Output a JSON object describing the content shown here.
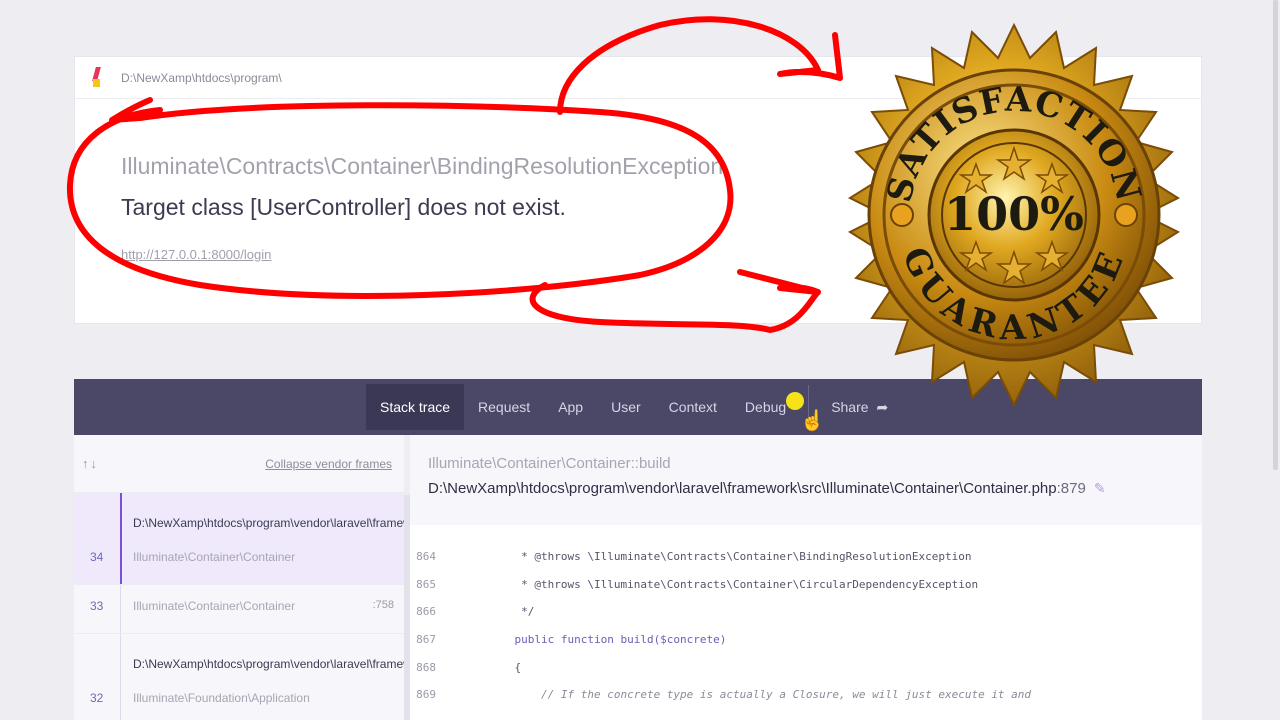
{
  "header": {
    "path": "D:\\NewXamp\\htdocs\\program\\",
    "exception_class": "Illuminate\\Contracts\\Container\\BindingResolutionException",
    "message": "Target class [UserController] does not exist.",
    "url": "http://127.0.0.1:8000/login"
  },
  "tabs": [
    "Stack trace",
    "Request",
    "App",
    "User",
    "Context",
    "Debug"
  ],
  "share_label": "Share",
  "sidebar": {
    "arrows": "↑↓",
    "collapse_label": "Collapse vendor frames",
    "frames": [
      {
        "num": "34",
        "path": "D:\\NewXamp\\htdocs\\program\\vendor\\laravel\\framework\\src\\Illuminate\\Container\\Container.php",
        "cls": "Illuminate\\Container\\Container",
        "line": ""
      },
      {
        "num": "33",
        "path": "",
        "cls": "Illuminate\\Container\\Container",
        "line": ":758"
      },
      {
        "num": "32",
        "path": "D:\\NewXamp\\htdocs\\program\\vendor\\laravel\\framework\\src\\Illuminate\\Foundation\\Application.php",
        "cls": "Illuminate\\Foundation\\Application",
        "line": ""
      }
    ]
  },
  "main": {
    "method": "Illuminate\\Container\\Container::build",
    "filepath": "D:\\NewXamp\\htdocs\\program\\vendor\\laravel\\framework\\src\\Illuminate\\Container\\Container.php",
    "line": ":879"
  },
  "code_lines": [
    {
      "ln": "864",
      "text": "     * @throws \\Illuminate\\Contracts\\Container\\BindingResolutionException",
      "kind": "doc"
    },
    {
      "ln": "865",
      "text": "     * @throws \\Illuminate\\Contracts\\Container\\CircularDependencyException",
      "kind": "doc"
    },
    {
      "ln": "866",
      "text": "     */",
      "kind": "doc"
    },
    {
      "ln": "867",
      "text": "    public function build($concrete)",
      "kind": "kw"
    },
    {
      "ln": "868",
      "text": "    {",
      "kind": "doc"
    },
    {
      "ln": "869",
      "text": "        // If the concrete type is actually a Closure, we will just execute it and",
      "kind": "cm"
    }
  ],
  "badge": {
    "top_text": "SATISFACTION",
    "center_text": "100%",
    "bottom_text": "GUARANTEE"
  },
  "colors": {
    "tabbar": "#4a4866",
    "scribble": "#ff0000",
    "gold": "#d9a520"
  }
}
